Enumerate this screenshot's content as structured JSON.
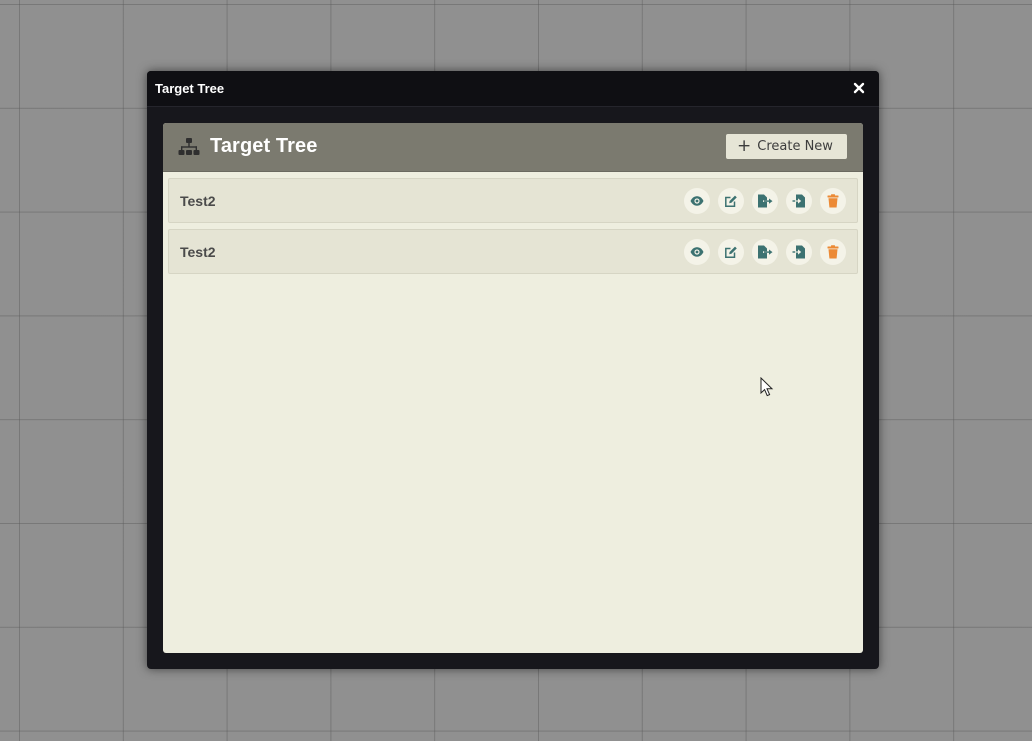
{
  "window": {
    "title": "Target Tree",
    "close_glyph": "×"
  },
  "panel": {
    "title": "Target Tree",
    "header_icon": "sitemap-icon",
    "create_button": {
      "label": "Create New",
      "icon": "plus-icon"
    }
  },
  "rows": [
    {
      "label": "Test2",
      "actions": [
        "view-icon",
        "edit-icon",
        "export-icon",
        "import-icon",
        "delete-icon"
      ]
    },
    {
      "label": "Test2",
      "actions": [
        "view-icon",
        "edit-icon",
        "export-icon",
        "import-icon",
        "delete-icon"
      ]
    }
  ],
  "colors": {
    "action_icon": "#3c7271",
    "delete_icon": "#ec8a35",
    "header_bg": "#7b7a6f",
    "panel_bg": "#eeeedf"
  }
}
